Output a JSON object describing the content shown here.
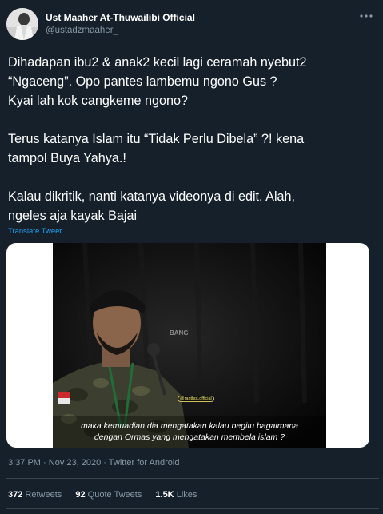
{
  "author": {
    "name": "Ust Maaher At-Thuwailibi Official",
    "handle": "@ustadzmaaher_"
  },
  "tweet": {
    "lines": [
      "Dihadapan ibu2 & anak2 kecil lagi ceramah nyebut2",
      "“Ngaceng”. Opo pantes lambemu ngono Gus ?",
      "Kyai lah kok cangkeme ngono?",
      "Terus katanya Islam itu “Tidak Perlu Dibela” ?! kena",
      "tampol Buya Yahya.!",
      "Kalau dikritik, nanti katanya videonya di edit. Alah,",
      "ngeles aja kayak Bajai"
    ],
    "translate_label": "Translate Tweet"
  },
  "media": {
    "caption_line1": "maka kemuadian dia mengatakan kalau begitu bagaimana",
    "caption_line2": "dengan Ormas yang mengatakan membela islam ?",
    "watermark": "BANG",
    "channel_tag": "@ranthpLofficial"
  },
  "meta": {
    "time": "3:37 PM",
    "date": "Nov 23, 2020",
    "source": "Twitter for Android",
    "separator": "·"
  },
  "stats": {
    "retweets_count": "372",
    "retweets_label": "Retweets",
    "quotes_count": "92",
    "quotes_label": "Quote Tweets",
    "likes_count": "1.5K",
    "likes_label": "Likes"
  },
  "icons": {
    "more": "more-horizontal-icon"
  },
  "colors": {
    "background": "#15202b",
    "text_secondary": "#8899a6",
    "link": "#1da1f2",
    "divider": "#38444d"
  }
}
